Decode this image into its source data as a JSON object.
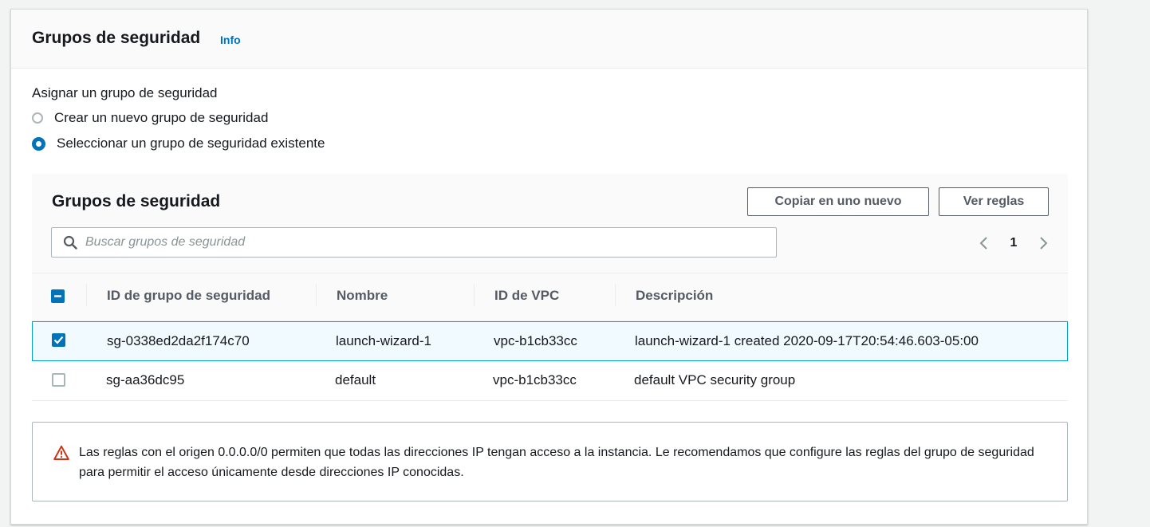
{
  "panel": {
    "title": "Grupos de seguridad",
    "info_link": "Info"
  },
  "assign": {
    "label": "Asignar un grupo de seguridad",
    "options": [
      {
        "label": "Crear un nuevo grupo de seguridad",
        "selected": false
      },
      {
        "label": "Seleccionar un grupo de seguridad existente",
        "selected": true
      }
    ]
  },
  "table": {
    "title": "Grupos de seguridad",
    "copy_button": "Copiar en uno nuevo",
    "rules_button": "Ver reglas",
    "search_placeholder": "Buscar grupos de seguridad",
    "page": "1",
    "columns": [
      "ID de grupo de seguridad",
      "Nombre",
      "ID de VPC",
      "Descripción"
    ],
    "rows": [
      {
        "checked": true,
        "id": "sg-0338ed2da2f174c70",
        "name": "launch-wizard-1",
        "vpc": "vpc-b1cb33cc",
        "description": "launch-wizard-1 created 2020-09-17T20:54:46.603-05:00"
      },
      {
        "checked": false,
        "id": "sg-aa36dc95",
        "name": "default",
        "vpc": "vpc-b1cb33cc",
        "description": "default VPC security group"
      }
    ]
  },
  "warning": {
    "icon": "warning-triangle-icon",
    "text": "Las reglas con el origen 0.0.0.0/0 permiten que todas las direcciones IP tengan acceso a la instancia. Le recomendamos que configure las reglas del grupo de seguridad para permitir el acceso únicamente desde direcciones IP conocidas."
  },
  "colors": {
    "accent": "#0073bb",
    "warning": "#d13212",
    "selected_row_border": "#00a1c9",
    "selected_row_bg": "#f1faff"
  }
}
